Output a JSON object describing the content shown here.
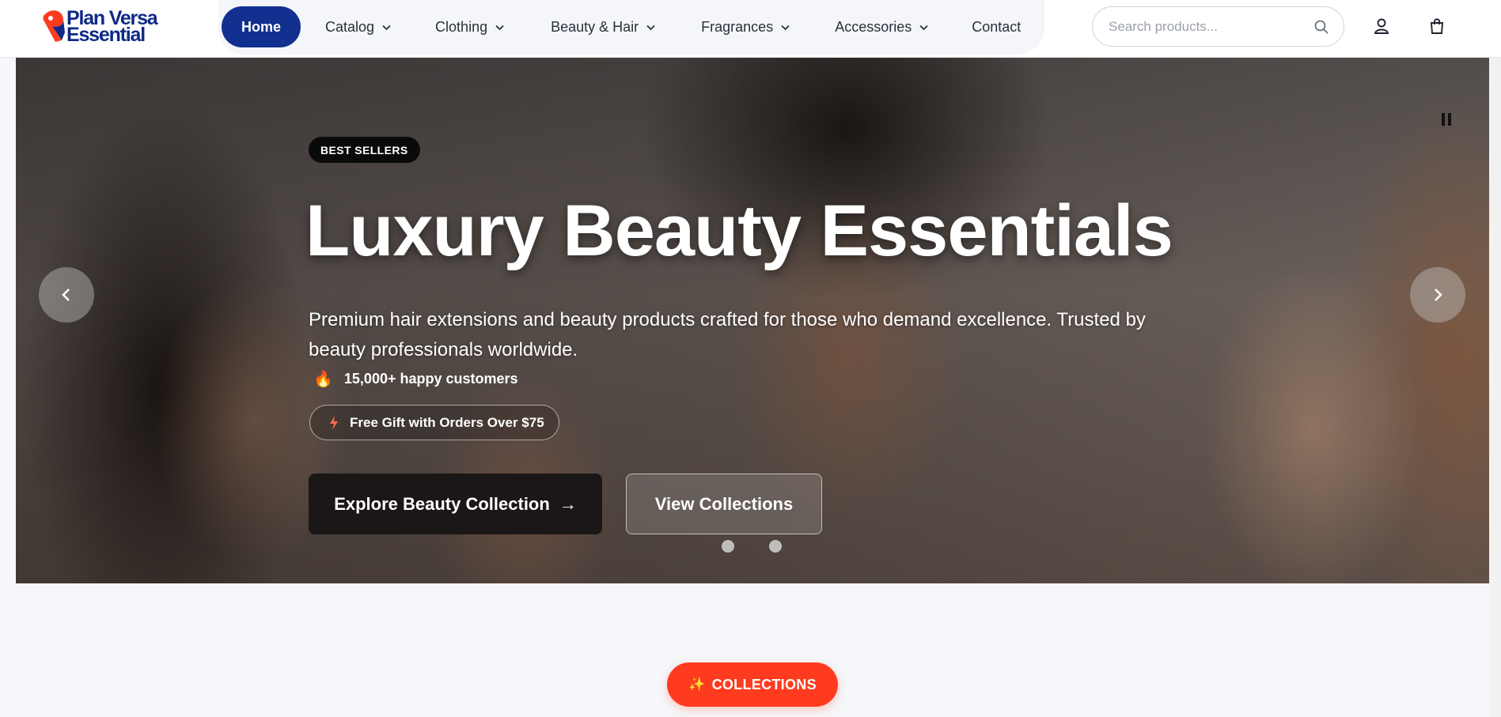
{
  "brand": {
    "name_line1": "Plan Versa",
    "name_line2": "Essential",
    "color_primary": "#0f2a86",
    "color_accent": "#ff3b1f"
  },
  "nav": {
    "items": [
      {
        "label": "Home",
        "active": true,
        "dropdown": false
      },
      {
        "label": "Catalog",
        "dropdown": true
      },
      {
        "label": "Clothing",
        "dropdown": true
      },
      {
        "label": "Beauty & Hair",
        "dropdown": true
      },
      {
        "label": "Fragrances",
        "dropdown": true
      },
      {
        "label": "Accessories",
        "dropdown": true
      },
      {
        "label": "Contact",
        "dropdown": false
      }
    ]
  },
  "search": {
    "placeholder": "Search products...",
    "value": "",
    "icon": "search-icon"
  },
  "header_icons": [
    "user-icon",
    "shopping-bag-icon"
  ],
  "hero": {
    "badge": "BEST SELLERS",
    "title": "Luxury Beauty Essentials",
    "subtitle": "Premium hair extensions and beauty products crafted for those who demand excellence. Trusted by beauty professionals worldwide.",
    "customers_icon": "🔥",
    "customers_text": "15,000+ happy customers",
    "gift_text": "Free Gift with Orders Over $75",
    "primary_button": "Explore Beauty Collection",
    "primary_arrow": "→",
    "secondary_button": "View Collections",
    "slide_count": 2,
    "controls": [
      "chevron-left-icon",
      "chevron-right-icon",
      "pause-icon"
    ]
  },
  "collections_section": {
    "pill_icon": "✨",
    "pill_label": "COLLECTIONS"
  }
}
